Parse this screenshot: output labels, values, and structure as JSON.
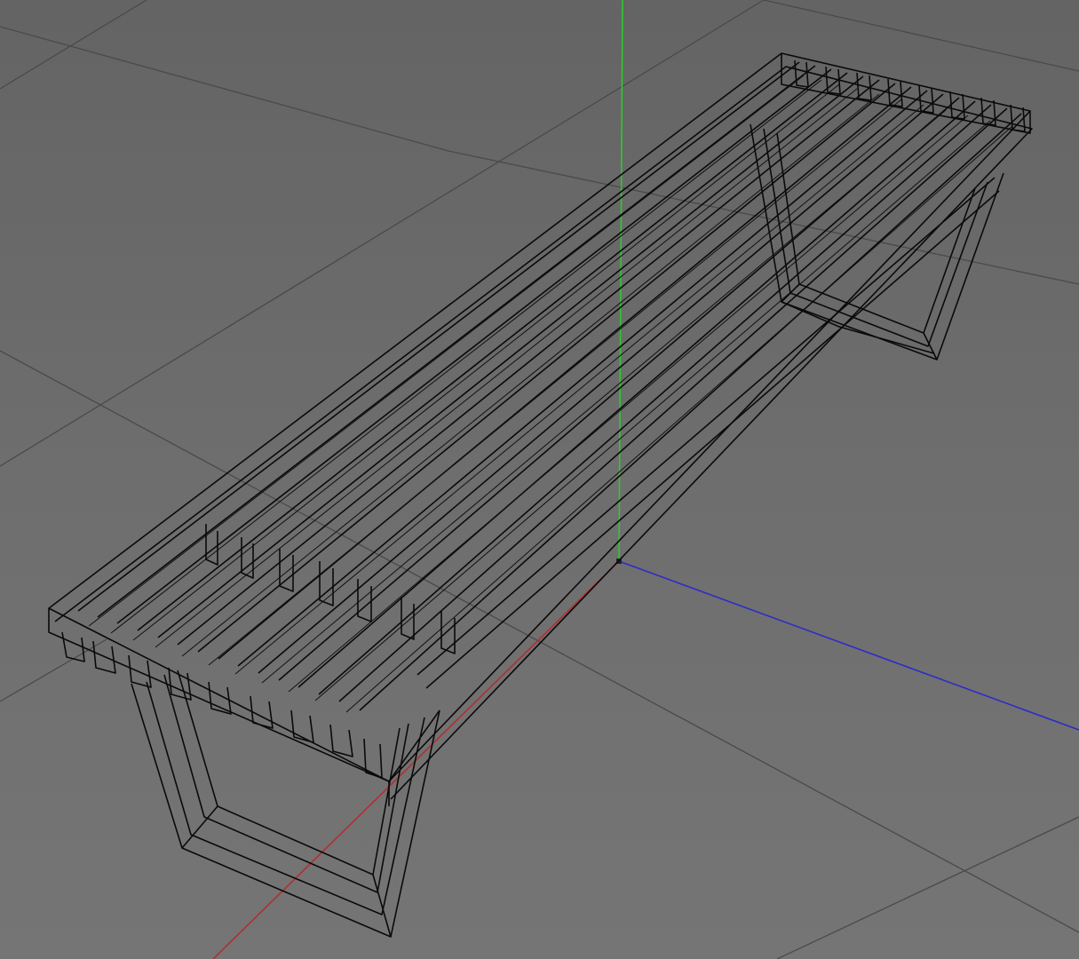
{
  "viewport": {
    "view_mode": "perspective",
    "display_mode": "wireframe",
    "object": "bench",
    "background_color": "#6f6f6f",
    "grid_color": "#4a4a4a",
    "wire_color": "#0a0a0a"
  },
  "axes": {
    "x_color": "#b03030",
    "y_color": "#2fc82f",
    "z_color": "#2c2cc8"
  }
}
